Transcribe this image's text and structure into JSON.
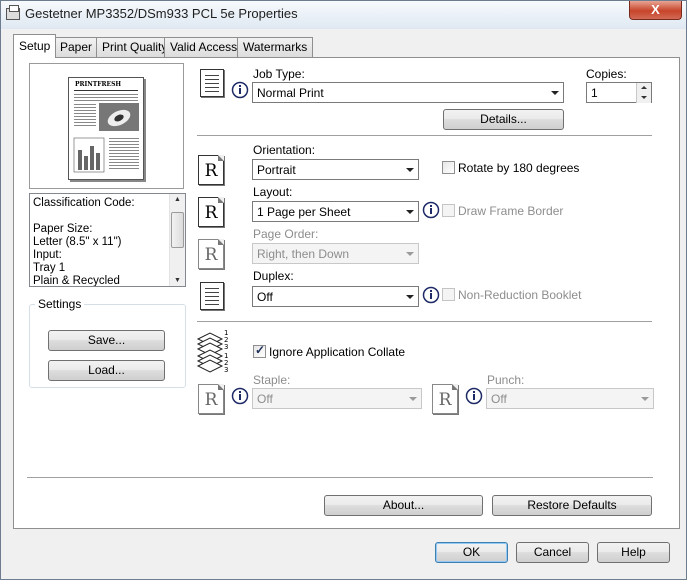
{
  "window": {
    "title": "Gestetner MP3352/DSm933 PCL 5e Properties",
    "close_label": "X"
  },
  "tabs": [
    {
      "label": "Setup"
    },
    {
      "label": "Paper"
    },
    {
      "label": "Print Quality"
    },
    {
      "label": "Valid Access"
    },
    {
      "label": "Watermarks"
    }
  ],
  "preview": {
    "masthead": "PRINTFRESH"
  },
  "classification": {
    "lines": [
      "Classification Code:",
      "",
      "Paper Size:",
      " Letter (8.5\" x 11\")",
      "Input:",
      " Tray 1",
      " Plain & Recycled"
    ]
  },
  "settings": {
    "group_label": "Settings",
    "save_label": "Save...",
    "load_label": "Load..."
  },
  "job": {
    "job_type_label": "Job Type:",
    "job_type_value": "Normal Print",
    "copies_label": "Copies:",
    "copies_value": "1",
    "details_label": "Details..."
  },
  "orientation": {
    "label": "Orientation:",
    "value": "Portrait",
    "rotate_label": "Rotate by 180 degrees",
    "rotate_checked": false
  },
  "layout": {
    "label": "Layout:",
    "value": "1 Page per Sheet",
    "frame_label": "Draw Frame Border",
    "page_order_label": "Page Order:",
    "page_order_value": "Right, then Down"
  },
  "duplex": {
    "label": "Duplex:",
    "value": "Off",
    "non_reduction_label": "Non-Reduction Booklet"
  },
  "collate": {
    "label": "Ignore Application Collate",
    "checked": true,
    "icon_digits": [
      "1",
      "2",
      "3",
      "1",
      "2",
      "3"
    ]
  },
  "finishing": {
    "staple_label": "Staple:",
    "staple_value": "Off",
    "punch_label": "Punch:",
    "punch_value": "Off"
  },
  "bottom": {
    "about_label": "About...",
    "restore_label": "Restore Defaults"
  },
  "dialog": {
    "ok_label": "OK",
    "cancel_label": "Cancel",
    "help_label": "Help"
  },
  "icons": {
    "r_glyph": "R",
    "info_glyph": "i"
  }
}
